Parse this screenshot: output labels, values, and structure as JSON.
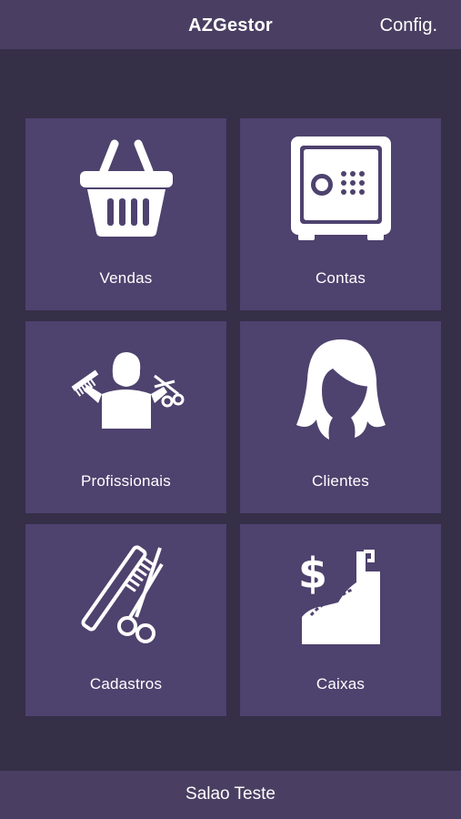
{
  "header": {
    "title": "AZGestor",
    "config_label": "Config."
  },
  "tiles": [
    {
      "label": "Vendas",
      "icon": "shopping-basket-icon"
    },
    {
      "label": "Contas",
      "icon": "safe-icon"
    },
    {
      "label": "Profissionais",
      "icon": "barber-icon"
    },
    {
      "label": "Clientes",
      "icon": "woman-hair-icon"
    },
    {
      "label": "Cadastros",
      "icon": "comb-scissors-icon"
    },
    {
      "label": "Caixas",
      "icon": "cash-register-icon"
    }
  ],
  "footer": {
    "text": "Salao Teste"
  },
  "colors": {
    "background": "#352f48",
    "bars": "#4a3f62",
    "tile": "#4e426e",
    "icon": "#ffffff"
  }
}
